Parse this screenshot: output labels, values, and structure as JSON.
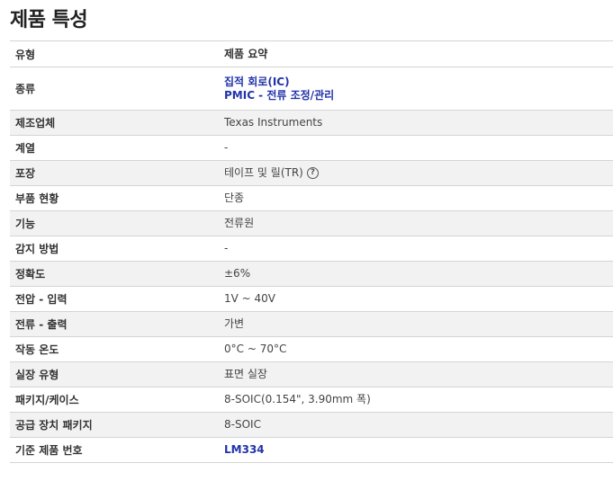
{
  "page_title": "제품 특성",
  "table": {
    "header": {
      "label": "유형",
      "value": "제품 요약"
    },
    "category": {
      "label": "종류",
      "links": [
        "집적 회로(IC)",
        "PMIC - 전류 조정/관리"
      ]
    },
    "manufacturer": {
      "label": "제조업체",
      "value": "Texas Instruments"
    },
    "series": {
      "label": "계열",
      "value": "-"
    },
    "packaging": {
      "label": "포장",
      "value": "테이프 및 릴(TR)",
      "help_icon": "question-circle-icon"
    },
    "part_status": {
      "label": "부품 현황",
      "value": "단종"
    },
    "function": {
      "label": "기능",
      "value": "전류원"
    },
    "sensing_method": {
      "label": "감지 방법",
      "value": "-"
    },
    "accuracy": {
      "label": "정확도",
      "value": "±6%"
    },
    "voltage_input": {
      "label": "전압 - 입력",
      "value": "1V ~ 40V"
    },
    "current_output": {
      "label": "전류 - 출력",
      "value": "가변"
    },
    "operating_temp": {
      "label": "작동 온도",
      "value": "0°C ~ 70°C"
    },
    "mounting_type": {
      "label": "실장 유형",
      "value": "표면 실장"
    },
    "package_case": {
      "label": "패키지/케이스",
      "value": "8-SOIC(0.154\", 3.90mm 폭)"
    },
    "supplier_package": {
      "label": "공급 장치 패키지",
      "value": "8-SOIC"
    },
    "base_part_number": {
      "label": "기준 제품 번호",
      "value": "LM334"
    }
  },
  "colors": {
    "link": "#2233aa",
    "row_shade": "#f2f2f2",
    "border": "#d4d4d4"
  }
}
